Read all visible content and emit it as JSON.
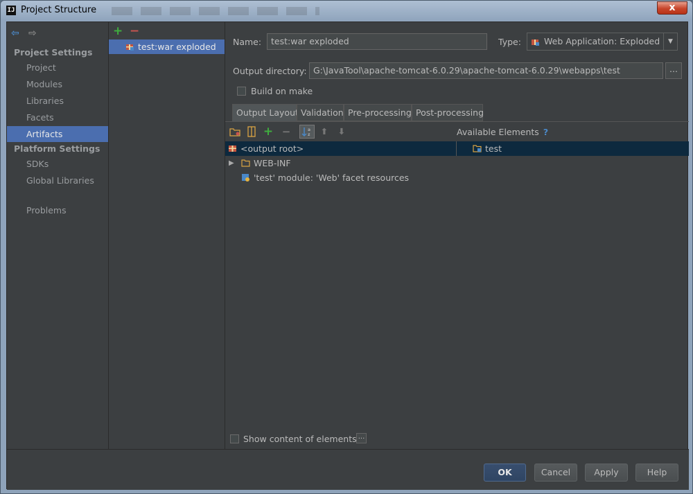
{
  "window": {
    "title": "Project Structure",
    "icon_text": "IJ",
    "close_label": "x"
  },
  "sidebar": {
    "project_settings_header": "Project Settings",
    "project_items": [
      "Project",
      "Modules",
      "Libraries",
      "Facets",
      "Artifacts"
    ],
    "platform_settings_header": "Platform Settings",
    "platform_items": [
      "SDKs",
      "Global Libraries"
    ],
    "problems": "Problems"
  },
  "artifacts": {
    "add_label": "+",
    "remove_label": "−",
    "selected": "test:war exploded"
  },
  "form": {
    "name_label": "Name:",
    "name_value": "test:war exploded",
    "type_label": "Type:",
    "type_value": "Web Application: Exploded",
    "output_dir_label": "Output directory:",
    "output_dir_value": "G:\\JavaTool\\apache-tomcat-6.0.29\\apache-tomcat-6.0.29\\webapps\\test",
    "browse_label": "...",
    "build_on_make_label": "Build on make"
  },
  "tabs": [
    "Output Layout",
    "Validation",
    "Pre-processing",
    "Post-processing"
  ],
  "layout": {
    "available_elements": "Available Elements",
    "help": "?",
    "tree": [
      "<output root>",
      "WEB-INF",
      "'test' module: 'Web' facet resources"
    ],
    "available_tree": [
      "test"
    ],
    "show_content_label": "Show content of elements",
    "show_content_btn": "..."
  },
  "buttons": {
    "ok": "OK",
    "cancel": "Cancel",
    "apply": "Apply",
    "help": "Help"
  },
  "colors": {
    "selection": "#4b6eaf",
    "tree_selection": "#0d293e",
    "background": "#3c3f41"
  }
}
